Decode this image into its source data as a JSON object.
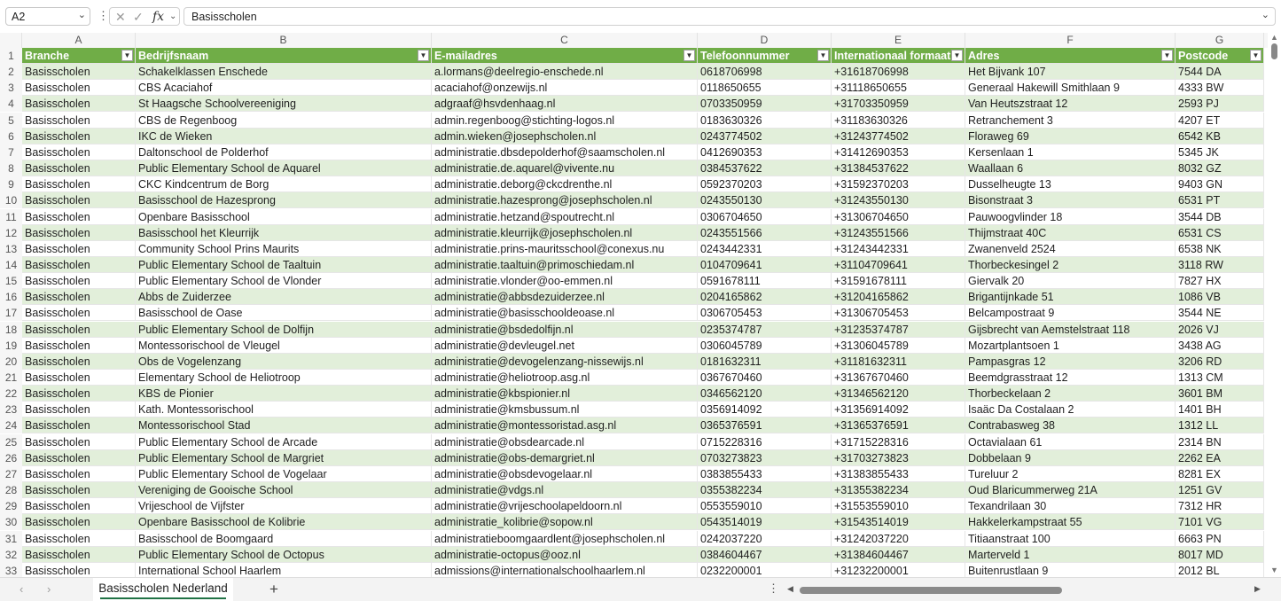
{
  "formula_bar": {
    "name_box": "A2",
    "fx_label": "fx",
    "formula": "Basisscholen",
    "cancel_icon": "close-icon",
    "enter_icon": "check-icon"
  },
  "columns": [
    "A",
    "B",
    "C",
    "D",
    "E",
    "F",
    "G"
  ],
  "headers": [
    "Branche",
    "Bedrijfsnaam",
    "E-mailadres",
    "Telefoonnummer",
    "Internationaal formaat",
    "Adres",
    "Postcode"
  ],
  "rows": [
    [
      "Basisscholen",
      "Schakelklassen Enschede",
      "a.lormans@deelregio-enschede.nl",
      "0618706998",
      "+31618706998",
      "Het Bijvank 107",
      "7544 DA"
    ],
    [
      "Basisscholen",
      "CBS Acaciahof",
      "acaciahof@onzewijs.nl",
      "0118650655",
      "+31118650655",
      "Generaal Hakewill Smithlaan 9",
      "4333 BW"
    ],
    [
      "Basisscholen",
      "St Haagsche Schoolvereeniging",
      "adgraaf@hsvdenhaag.nl",
      "0703350959",
      "+31703350959",
      "Van Heutszstraat 12",
      "2593 PJ"
    ],
    [
      "Basisscholen",
      "CBS de Regenboog",
      "admin.regenboog@stichting-logos.nl",
      "0183630326",
      "+31183630326",
      "Retranchement 3",
      "4207 ET"
    ],
    [
      "Basisscholen",
      "IKC de Wieken",
      "admin.wieken@josephscholen.nl",
      "0243774502",
      "+31243774502",
      "Floraweg 69",
      "6542 KB"
    ],
    [
      "Basisscholen",
      "Daltonschool de Polderhof",
      "administratie.dbsdepolderhof@saamscholen.nl",
      "0412690353",
      "+31412690353",
      "Kersenlaan 1",
      "5345 JK"
    ],
    [
      "Basisscholen",
      "Public Elementary School de Aquarel",
      "administratie.de.aquarel@vivente.nu",
      "0384537622",
      "+31384537622",
      "Waallaan 6",
      "8032 GZ"
    ],
    [
      "Basisscholen",
      "CKC Kindcentrum de Borg",
      "administratie.deborg@ckcdrenthe.nl",
      "0592370203",
      "+31592370203",
      "Dusselheugte 13",
      "9403 GN"
    ],
    [
      "Basisscholen",
      "Basisschool de Hazesprong",
      "administratie.hazesprong@josephscholen.nl",
      "0243550130",
      "+31243550130",
      "Bisonstraat 3",
      "6531 PT"
    ],
    [
      "Basisscholen",
      "Openbare Basisschool",
      "administratie.hetzand@spoutrecht.nl",
      "0306704650",
      "+31306704650",
      "Pauwoogvlinder 18",
      "3544 DB"
    ],
    [
      "Basisscholen",
      "Basisschool het Kleurrijk",
      "administratie.kleurrijk@josephscholen.nl",
      "0243551566",
      "+31243551566",
      "Thijmstraat 40C",
      "6531 CS"
    ],
    [
      "Basisscholen",
      "Community School Prins Maurits",
      "administratie.prins-mauritsschool@conexus.nu",
      "0243442331",
      "+31243442331",
      "Zwanenveld 2524",
      "6538 NK"
    ],
    [
      "Basisscholen",
      "Public Elementary School de Taaltuin",
      "administratie.taaltuin@primoschiedam.nl",
      "0104709641",
      "+31104709641",
      "Thorbeckesingel 2",
      "3118 RW"
    ],
    [
      "Basisscholen",
      "Public Elementary School de Vlonder",
      "administratie.vlonder@oo-emmen.nl",
      "0591678111",
      "+31591678111",
      "Giervalk 20",
      "7827 HX"
    ],
    [
      "Basisscholen",
      "Abbs de Zuiderzee",
      "administratie@abbsdezuiderzee.nl",
      "0204165862",
      "+31204165862",
      "Brigantijnkade 51",
      "1086 VB"
    ],
    [
      "Basisscholen",
      "Basisschool de Oase",
      "administratie@basisschooldeoase.nl",
      "0306705453",
      "+31306705453",
      "Belcampostraat 9",
      "3544 NE"
    ],
    [
      "Basisscholen",
      "Public Elementary School de Dolfijn",
      "administratie@bsdedolfijn.nl",
      "0235374787",
      "+31235374787",
      "Gijsbrecht van Aemstelstraat 118",
      "2026 VJ"
    ],
    [
      "Basisscholen",
      "Montessorischool de Vleugel",
      "administratie@devleugel.net",
      "0306045789",
      "+31306045789",
      "Mozartplantsoen 1",
      "3438 AG"
    ],
    [
      "Basisscholen",
      "Obs de Vogelenzang",
      "administratie@devogelenzang-nissewijs.nl",
      "0181632311",
      "+31181632311",
      "Pampasgras 12",
      "3206 RD"
    ],
    [
      "Basisscholen",
      "Elementary School de Heliotroop",
      "administratie@heliotroop.asg.nl",
      "0367670460",
      "+31367670460",
      "Beemdgrasstraat 12",
      "1313 CM"
    ],
    [
      "Basisscholen",
      "KBS de Pionier",
      "administratie@kbspionier.nl",
      "0346562120",
      "+31346562120",
      "Thorbeckelaan 2",
      "3601 BM"
    ],
    [
      "Basisscholen",
      "Kath. Montessorischool",
      "administratie@kmsbussum.nl",
      "0356914092",
      "+31356914092",
      "Isaäc Da Costalaan 2",
      "1401 BH"
    ],
    [
      "Basisscholen",
      "Montessorischool Stad",
      "administratie@montessoristad.asg.nl",
      "0365376591",
      "+31365376591",
      "Contrabasweg 38",
      "1312 LL"
    ],
    [
      "Basisscholen",
      "Public Elementary School de Arcade",
      "administratie@obsdearcade.nl",
      "0715228316",
      "+31715228316",
      "Octavialaan 61",
      "2314 BN"
    ],
    [
      "Basisscholen",
      "Public Elementary School de Margriet",
      "administratie@obs-demargriet.nl",
      "0703273823",
      "+31703273823",
      "Dobbelaan 9",
      "2262 EA"
    ],
    [
      "Basisscholen",
      "Public Elementary School de Vogelaar",
      "administratie@obsdevogelaar.nl",
      "0383855433",
      "+31383855433",
      "Tureluur 2",
      "8281 EX"
    ],
    [
      "Basisscholen",
      "Vereniging de Gooische School",
      "administratie@vdgs.nl",
      "0355382234",
      "+31355382234",
      "Oud Blaricummerweg 21A",
      "1251 GV"
    ],
    [
      "Basisscholen",
      "Vrijeschool de Vijfster",
      "administratie@vrijeschoolapeldoorn.nl",
      "0553559010",
      "+31553559010",
      "Texandrilaan 30",
      "7312 HR"
    ],
    [
      "Basisscholen",
      "Openbare Basisschool de Kolibrie",
      "administratie_kolibrie@sopow.nl",
      "0543514019",
      "+31543514019",
      "Hakkelerkampstraat 55",
      "7101 VG"
    ],
    [
      "Basisscholen",
      "Basisschool de Boomgaard",
      "administratieboomgaardlent@josephscholen.nl",
      "0242037220",
      "+31242037220",
      "Titiaanstraat 100",
      "6663 PN"
    ],
    [
      "Basisscholen",
      "Public Elementary School de Octopus",
      "administratie-octopus@ooz.nl",
      "0384604467",
      "+31384604467",
      "Marterveld 1",
      "8017 MD"
    ],
    [
      "Basisscholen",
      "International School Haarlem",
      "admissions@internationalschoolhaarlem.nl",
      "0232200001",
      "+31232200001",
      "Buitenrustlaan 9",
      "2012 BL"
    ]
  ],
  "sheet_tab": "Basisscholen Nederland",
  "colors": {
    "header_green": "#70ad47",
    "band_green": "#e2efda",
    "tab_underline": "#217346"
  }
}
